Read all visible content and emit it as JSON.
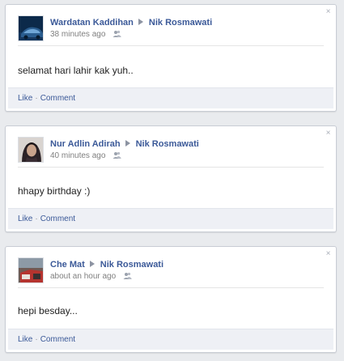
{
  "posts": [
    {
      "author": "Wardatan Kaddihan",
      "recipient": "Nik Rosmawati",
      "time": "38 minutes ago",
      "message": "selamat hari lahir kak yuh..",
      "like": "Like",
      "comment": "Comment",
      "dot": "·"
    },
    {
      "author": "Nur Adlin Adirah",
      "recipient": "Nik Rosmawati",
      "time": "40 minutes ago",
      "message": "hhapy birthday :)",
      "like": "Like",
      "comment": "Comment",
      "dot": "·"
    },
    {
      "author": "Che Mat",
      "recipient": "Nik Rosmawati",
      "time": "about an hour ago",
      "message": "hepi besday...",
      "like": "Like",
      "comment": "Comment",
      "dot": "·"
    }
  ],
  "icons": {
    "close": "close-icon",
    "audience": "friends-icon",
    "arrow": "arrow-right-icon"
  },
  "colors": {
    "link": "#3b5998",
    "action_bar": "#eef0f5",
    "background": "#e9ebee"
  }
}
